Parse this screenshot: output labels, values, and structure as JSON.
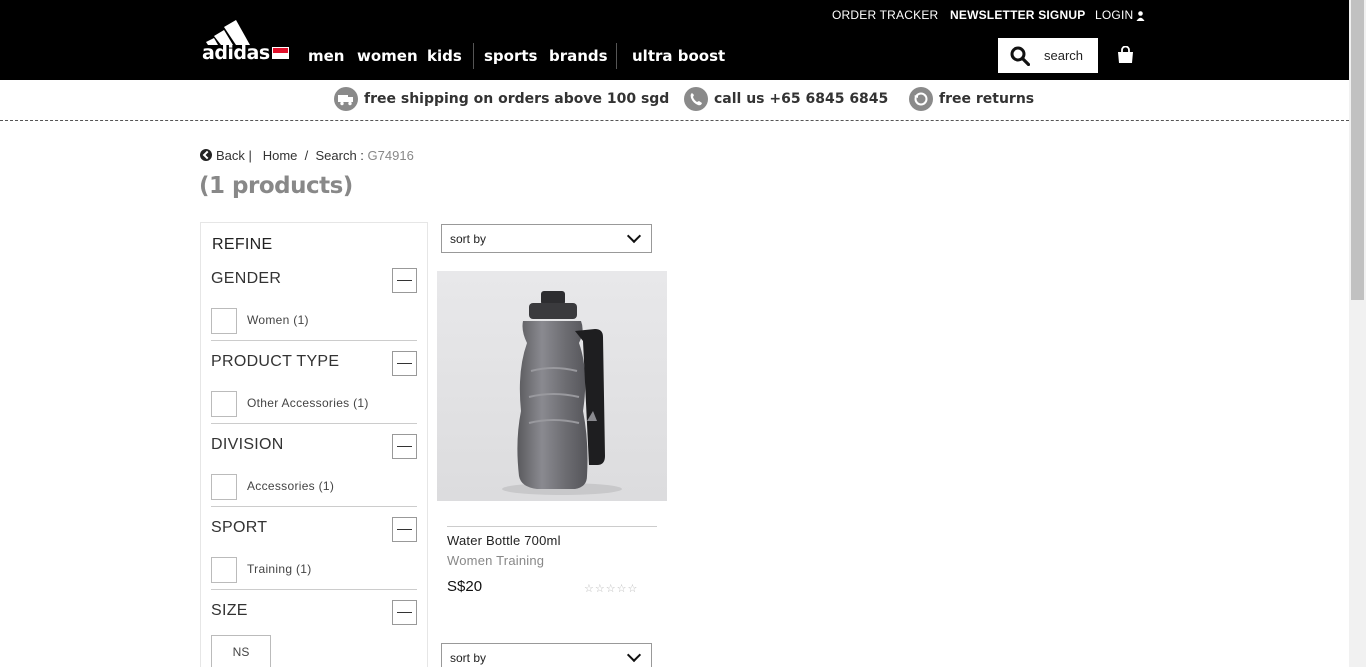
{
  "header": {
    "order_tracker": "ORDER TRACKER",
    "newsletter": "NEWSLETTER SIGNUP",
    "login": "LOGIN",
    "brand": "adidas",
    "nav": [
      "men",
      "women",
      "kids",
      "sports",
      "brands",
      "ultra boost"
    ],
    "search_label": "search"
  },
  "promo": {
    "shipping": "free shipping on orders above 100 sgd",
    "call": "call us +65 6845 6845",
    "returns": "free returns"
  },
  "breadcrumb": {
    "back": "Back",
    "home": "Home",
    "search_prefix": "Search :",
    "query": "G74916"
  },
  "results_count": "(1 products)",
  "refine": {
    "title": "REFINE",
    "facets": [
      {
        "title": "GENDER",
        "option": "Women",
        "count": "(1)"
      },
      {
        "title": "PRODUCT TYPE",
        "option": "Other Accessories",
        "count": "(1)"
      },
      {
        "title": "DIVISION",
        "option": "Accessories",
        "count": "(1)"
      },
      {
        "title": "SPORT",
        "option": "Training",
        "count": "(1)"
      },
      {
        "title": "SIZE",
        "option": "NS"
      }
    ]
  },
  "sort_label": "sort by",
  "product": {
    "name": "Water Bottle 700ml",
    "category": "Women Training",
    "price": "S$20",
    "rating_stars": "☆☆☆☆☆"
  }
}
